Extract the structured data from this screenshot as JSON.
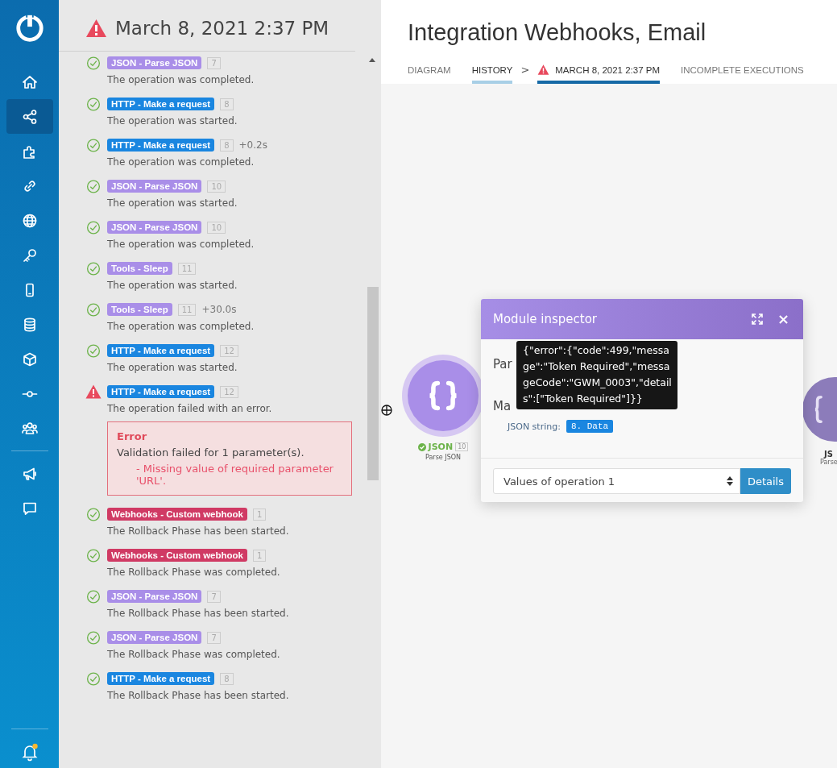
{
  "sidebar": {
    "items": [
      {
        "selected": false
      },
      {
        "selected": true
      },
      {
        "selected": false
      },
      {
        "selected": false
      },
      {
        "selected": false
      },
      {
        "selected": false
      },
      {
        "selected": false
      },
      {
        "selected": false
      },
      {
        "selected": false
      },
      {
        "selected": false
      },
      {
        "selected": false
      },
      {
        "selected": false
      },
      {
        "selected": false
      }
    ],
    "notifications": {
      "unread": true
    }
  },
  "log": {
    "title": "March 8, 2021 2:37 PM",
    "failed": true,
    "entries": [
      {
        "failed": false,
        "module": "JSON - Parse JSON",
        "color": "#a98ee8",
        "number": "7",
        "message": "The operation was completed."
      },
      {
        "failed": false,
        "module": "HTTP - Make a request",
        "color": "#1a86e0",
        "number": "8",
        "message": "The operation was started."
      },
      {
        "failed": false,
        "module": "HTTP - Make a request",
        "color": "#1a86e0",
        "number": "8",
        "duration": "+0.2s",
        "message": "The operation was completed."
      },
      {
        "failed": false,
        "module": "JSON - Parse JSON",
        "color": "#a98ee8",
        "number": "10",
        "message": "The operation was started."
      },
      {
        "failed": false,
        "module": "JSON - Parse JSON",
        "color": "#a98ee8",
        "number": "10",
        "message": "The operation was completed."
      },
      {
        "failed": false,
        "module": "Tools - Sleep",
        "color": "#a98ee8",
        "number": "11",
        "message": "The operation was started."
      },
      {
        "failed": false,
        "module": "Tools - Sleep",
        "color": "#a98ee8",
        "number": "11",
        "duration": "+30.0s",
        "message": "The operation was completed."
      },
      {
        "failed": false,
        "module": "HTTP - Make a request",
        "color": "#1a86e0",
        "number": "12",
        "message": "The operation was started."
      },
      {
        "failed": true,
        "module": "HTTP - Make a request",
        "color": "#1a86e0",
        "number": "12",
        "message": "The operation failed with an error.",
        "error": {
          "title": "Error",
          "message": "Validation failed for 1 parameter(s).",
          "detail": "- Missing value of required parameter 'URL'."
        }
      },
      {
        "failed": false,
        "module": "Webhooks - Custom webhook",
        "color": "#d03a64",
        "number": "1",
        "message": "The Rollback Phase has been started."
      },
      {
        "failed": false,
        "module": "Webhooks - Custom webhook",
        "color": "#d03a64",
        "number": "1",
        "message": "The Rollback Phase was completed."
      },
      {
        "failed": false,
        "module": "JSON - Parse JSON",
        "color": "#a98ee8",
        "number": "7",
        "message": "The Rollback Phase has been started."
      },
      {
        "failed": false,
        "module": "JSON - Parse JSON",
        "color": "#a98ee8",
        "number": "7",
        "message": "The Rollback Phase was completed."
      },
      {
        "failed": false,
        "module": "HTTP - Make a request",
        "color": "#1a86e0",
        "number": "8",
        "message": "The Rollback Phase has been started."
      }
    ]
  },
  "main": {
    "title": "Integration Webhooks, Email",
    "tabs": [
      {
        "label": "DIAGRAM",
        "selected": false,
        "in_path": false,
        "warning": false
      },
      {
        "label": "HISTORY",
        "selected": false,
        "in_path": true,
        "warning": false
      },
      {
        "label": "MARCH 8, 2021 2:37 PM",
        "selected": true,
        "in_path": false,
        "warning": true
      },
      {
        "label": "INCOMPLETE EXECUTIONS",
        "selected": false,
        "in_path": false,
        "warning": false
      }
    ],
    "breadcrumb_separator": ">"
  },
  "canvas": {
    "nodes": [
      {
        "name": "JSON",
        "number": "10",
        "subtitle": "Parse JSON",
        "ok": true
      },
      {
        "name": "JS",
        "subtitle": "Parse"
      }
    ]
  },
  "inspector": {
    "title": "Module inspector",
    "section_1": "Par",
    "section_2": "Ma",
    "field_label": "JSON string:",
    "field_value": "8. Data",
    "tooltip": "{\"error\":{\"code\":499,\"message\":\"Token Required\",\"messageCode\":\"GWM_0003\",\"details\":[\"Token Required\"]}}",
    "operation_select": "Values of operation 1",
    "details_button": "Details"
  }
}
